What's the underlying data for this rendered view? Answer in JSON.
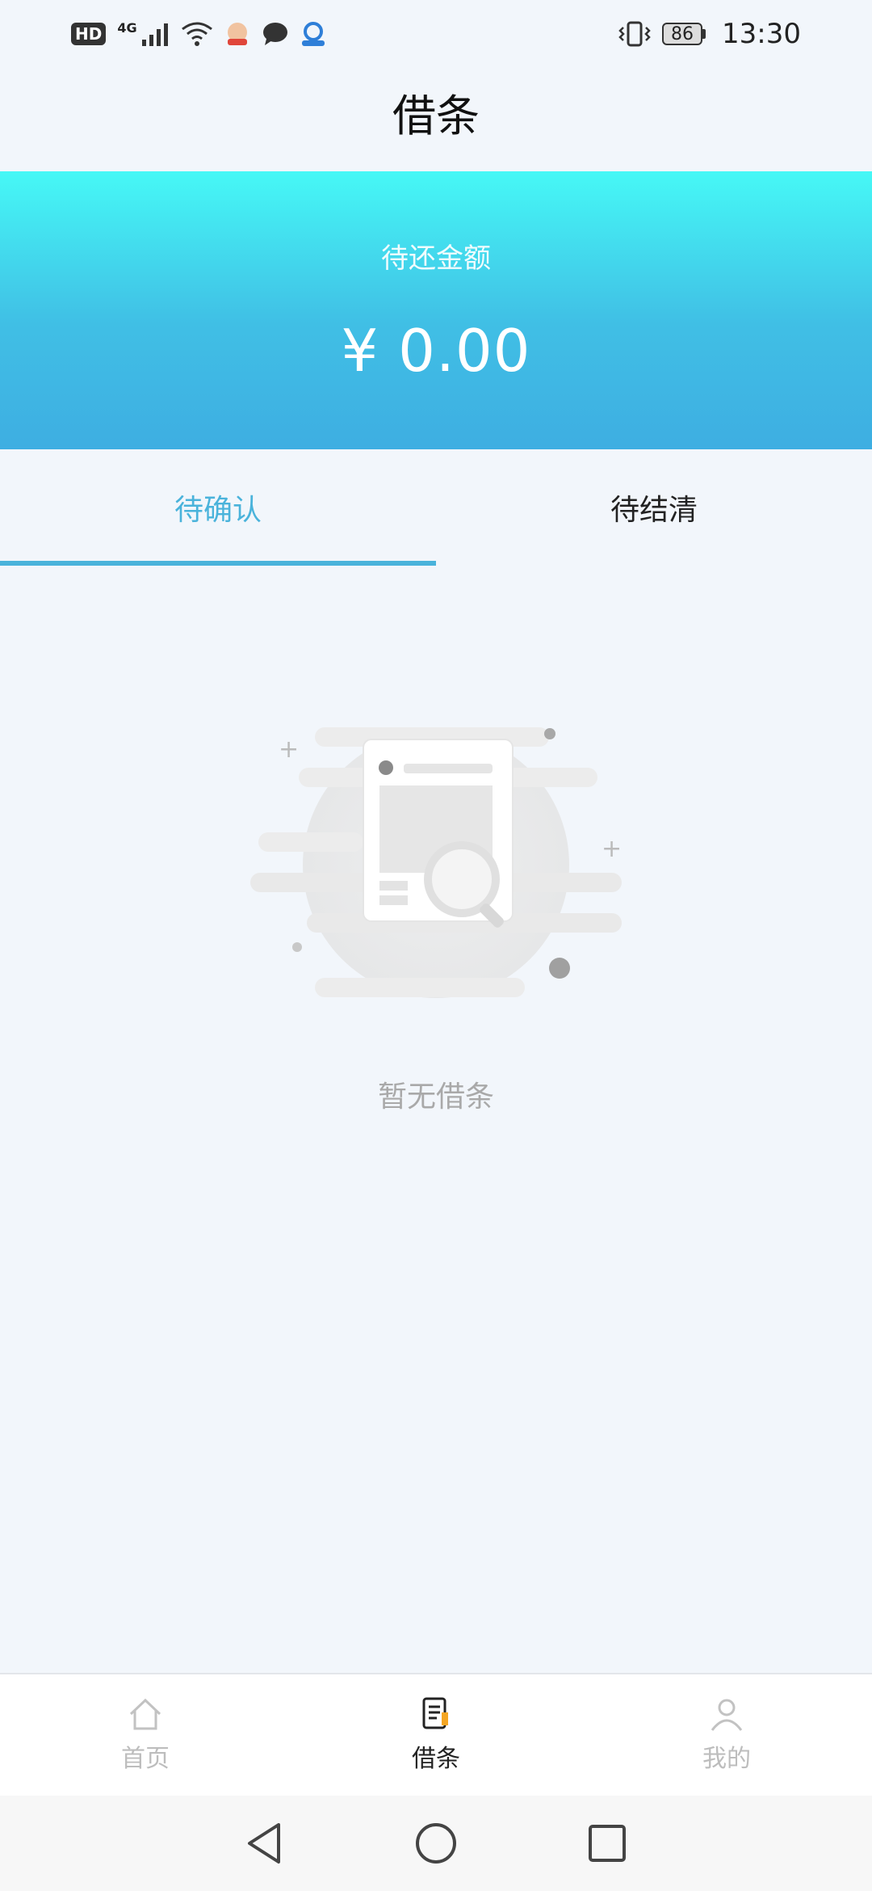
{
  "status_bar": {
    "hd": "HD",
    "network": "4G",
    "battery": "86",
    "time": "13:30",
    "icons": [
      "hd-icon",
      "signal-icon",
      "wifi-icon",
      "app-notification-icon",
      "message-icon",
      "app-notification-icon",
      "vibrate-icon",
      "battery-icon"
    ]
  },
  "header": {
    "title": "借条"
  },
  "banner": {
    "label": "待还金额",
    "amount": "¥ 0.00"
  },
  "tabs": [
    {
      "label": "待确认",
      "active": true
    },
    {
      "label": "待结清",
      "active": false
    }
  ],
  "empty_state": {
    "text": "暂无借条",
    "icon": "empty-document-search-icon"
  },
  "tabbar": {
    "items": [
      {
        "label": "首页",
        "icon": "home-icon",
        "active": false
      },
      {
        "label": "借条",
        "icon": "document-icon",
        "active": true
      },
      {
        "label": "我的",
        "icon": "user-icon",
        "active": false
      }
    ]
  },
  "system_nav": {
    "buttons": [
      "back-icon",
      "home-circle-icon",
      "recents-icon"
    ]
  },
  "colors": {
    "accent": "#4ab3db",
    "banner_top": "#46f8f6",
    "banner_bottom": "#3eaee2",
    "tabbar_active_icon": "#f5a623"
  }
}
